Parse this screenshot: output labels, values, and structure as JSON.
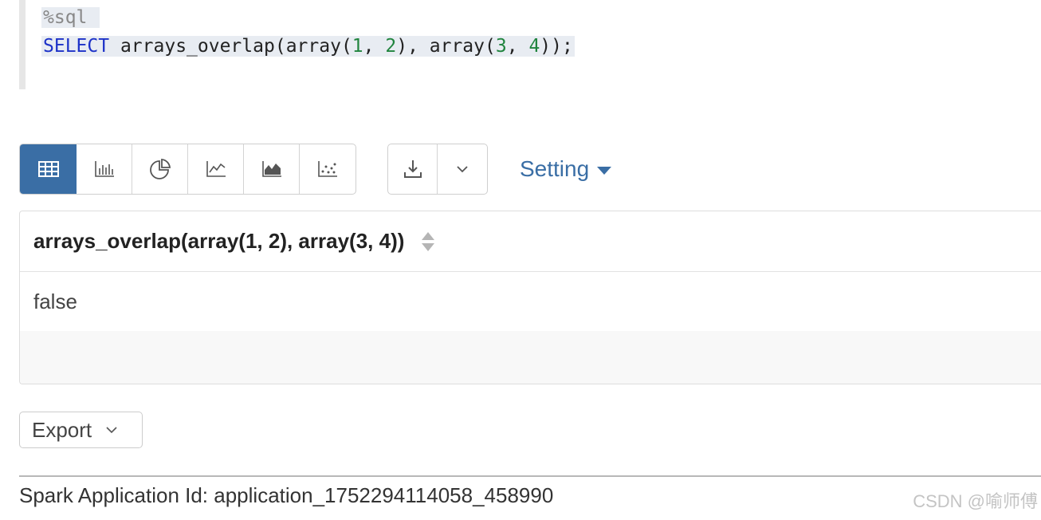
{
  "editor": {
    "magic": "%sql",
    "keyword": "SELECT",
    "fn": "arrays_overlap",
    "p1": "(",
    "arr": "array",
    "p2": "(",
    "n1": "1",
    "c1": ", ",
    "n2": "2",
    "p3": "), ",
    "arr2": "array",
    "p4": "(",
    "n3": "3",
    "c2": ", ",
    "n4": "4",
    "end": "));"
  },
  "toolbar": {
    "viz_buttons": [
      {
        "icon": "table-icon",
        "active": true
      },
      {
        "icon": "bar-chart-icon",
        "active": false
      },
      {
        "icon": "pie-chart-icon",
        "active": false
      },
      {
        "icon": "line-chart-icon",
        "active": false
      },
      {
        "icon": "area-chart-icon",
        "active": false
      },
      {
        "icon": "scatter-chart-icon",
        "active": false
      }
    ],
    "download_icon": "download-icon",
    "dropdown_icon": "chevron-down-icon",
    "setting_label": "Setting",
    "active_color": "#3a6ea5",
    "link_color": "#3a6ea5"
  },
  "table": {
    "header": "arrays_overlap(array(1, 2), array(3, 4))",
    "rows": [
      [
        "false"
      ]
    ]
  },
  "export": {
    "label": "Export"
  },
  "footer": {
    "app_id": "Spark Application Id: application_1752294114058_458990",
    "watermark": "CSDN @喻师傅"
  }
}
